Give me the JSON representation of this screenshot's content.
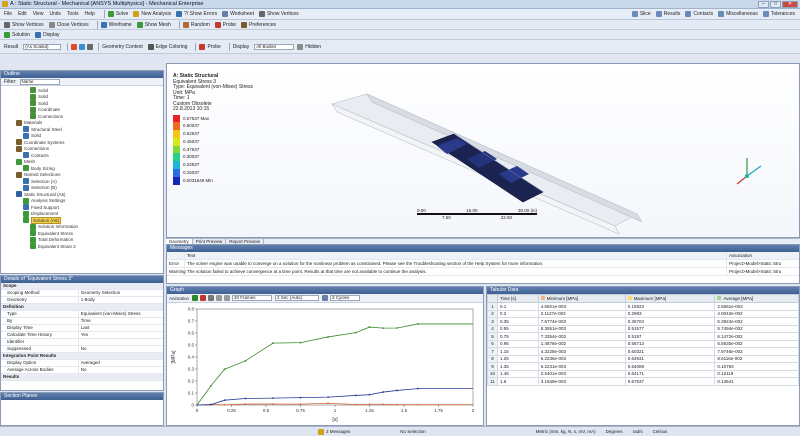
{
  "window": {
    "title": "A : Static Structural - Mechanical [ANSYS Multiphysics] - Mechanical Enterprise"
  },
  "menu": [
    "File",
    "Edit",
    "View",
    "Units",
    "Tools",
    "Help"
  ],
  "toolbar1": {
    "solve_label": "Solve",
    "new_analysis_label": "New Analysis",
    "show_errors_label": "?/ Show Errors",
    "worksheet_label": "Worksheet",
    "show_vertices_label": "Show Vertices"
  },
  "toolbar1_right": [
    "Slice",
    "Results",
    "Contacts",
    "Miscellaneous",
    "Tolerances"
  ],
  "toolbar2": [
    "Show Vertices",
    "Close Vertices",
    "Wireframe",
    "Show Mesh",
    "Random",
    "Probe",
    "Preferences"
  ],
  "toolbar3": [
    "Solution",
    "Display"
  ],
  "toolbar4": {
    "result_label": "Result",
    "result_value": "(As Scaled)",
    "geometry_label": "Geometry Context",
    "edge_coloring": "Edge Coloring",
    "probe": "Probe",
    "display": "Display",
    "display_value": "All Bodies",
    "hidden": "Hidden"
  },
  "outline": {
    "title": "Outline",
    "filter_label": "Filter:",
    "filter_value": "Name",
    "items": [
      {
        "label": "Solid",
        "indent": 3,
        "color": "#4a8f3a"
      },
      {
        "label": "Solid",
        "indent": 3,
        "color": "#4a8f3a"
      },
      {
        "label": "Solid",
        "indent": 3,
        "color": "#4a8f3a"
      },
      {
        "label": "Coordinate",
        "indent": 3,
        "color": "#4a8f3a"
      },
      {
        "label": "Connections",
        "indent": 3,
        "color": "#4a8f3a"
      },
      {
        "label": "Materials",
        "indent": 1,
        "color": "#7a5d2a"
      },
      {
        "label": "Structural Steel",
        "indent": 2,
        "color": "#3a6fb0"
      },
      {
        "label": "Solid",
        "indent": 2,
        "color": "#3a6fb0"
      },
      {
        "label": "Coordinate Systems",
        "indent": 1,
        "color": "#7a5d2a"
      },
      {
        "label": "Connections",
        "indent": 1,
        "color": "#7a5d2a"
      },
      {
        "label": "Contacts",
        "indent": 2,
        "color": "#3a6fb0"
      },
      {
        "label": "Mesh",
        "indent": 1,
        "color": "#3a9a3a"
      },
      {
        "label": "Body Sizing",
        "indent": 2,
        "color": "#3a9a3a"
      },
      {
        "label": "Named Selections",
        "indent": 1,
        "color": "#7a5d2a"
      },
      {
        "label": "Selection (A)",
        "indent": 2,
        "color": "#3a6fb0"
      },
      {
        "label": "Selection (B)",
        "indent": 2,
        "color": "#3a6fb0"
      },
      {
        "label": "Static Structural (A5)",
        "indent": 1,
        "color": "#2f5fa0"
      },
      {
        "label": "Analysis Settings",
        "indent": 2,
        "color": "#3a9a3a"
      },
      {
        "label": "Fixed Support",
        "indent": 2,
        "color": "#3a6fb0"
      },
      {
        "label": "Displacement",
        "indent": 2,
        "color": "#3a9a3a"
      },
      {
        "label": "Solution (A6)",
        "indent": 2,
        "color": "#3a9a3a",
        "highlight": true
      },
      {
        "label": "Solution Information",
        "indent": 3,
        "color": "#3a9a3a"
      },
      {
        "label": "Equivalent Stress",
        "indent": 3,
        "color": "#3a9a3a"
      },
      {
        "label": "Total Deformation",
        "indent": 3,
        "color": "#3a9a3a"
      },
      {
        "label": "Equivalent Strain 2",
        "indent": 3,
        "color": "#3a9a3a"
      }
    ]
  },
  "details": {
    "title": "Details of \"Equivalent Stress 3\"",
    "rows": [
      {
        "group": true,
        "k": "Scope"
      },
      {
        "k": "Scoping Method",
        "v": "Geometry Selection"
      },
      {
        "k": "Geometry",
        "v": "1 Body"
      },
      {
        "group": true,
        "k": "Definition"
      },
      {
        "k": "Type",
        "v": "Equivalent (von-Mises) Stress"
      },
      {
        "k": "By",
        "v": "Time"
      },
      {
        "k": "Display Time",
        "v": "Last"
      },
      {
        "k": "Calculate Time History",
        "v": "Yes"
      },
      {
        "k": "Identifier",
        "v": ""
      },
      {
        "k": "Suppressed",
        "v": "No"
      },
      {
        "group": true,
        "k": "Integration Point Results"
      },
      {
        "k": "Display Option",
        "v": "Averaged"
      },
      {
        "k": "Average Across Bodies",
        "v": "No"
      },
      {
        "group": true,
        "k": "Results"
      }
    ]
  },
  "section_planes": {
    "title": "Section Planes"
  },
  "viewport": {
    "title": "A: Static Structural",
    "subtitle": "Equivalent Stress 3",
    "lines": [
      "Type: Equivalent (von-Mises) Stress",
      "Unit: MPa",
      "Time: 1",
      "Custom Obsolete",
      "22.8.2013 10:15"
    ],
    "legend": [
      {
        "label": "0.67537 Max",
        "color": "#e8202a"
      },
      {
        "label": "0.60037",
        "color": "#f06a1e"
      },
      {
        "label": "0.52537",
        "color": "#f4c51c"
      },
      {
        "label": "0.45037",
        "color": "#d8e81a"
      },
      {
        "label": "0.37537",
        "color": "#7fd93a"
      },
      {
        "label": "0.30037",
        "color": "#2ccf8a"
      },
      {
        "label": "0.22537",
        "color": "#1fb7d6"
      },
      {
        "label": "0.15037",
        "color": "#2a6fe0"
      },
      {
        "label": "0.0031849 Min",
        "color": "#1428b8"
      }
    ],
    "scale": {
      "a": "0.00",
      "b": "15.00",
      "c": "30.00 (in)",
      "d": "7.50",
      "e": "22.50"
    }
  },
  "vp_tabs": [
    "Geometry",
    "Print Preview",
    "Report Preview"
  ],
  "messages": {
    "title": "Messages",
    "col_text": "Text",
    "col_assoc": "Association",
    "rows": [
      {
        "type": "Error",
        "text": "The solver engine was unable to converge on a solution for the nonlinear problem as constrained. Please see the Troubleshooting section of the Help System for more information.",
        "assoc": "Project>Model>Static Stru"
      },
      {
        "type": "Warning",
        "text": "The solution failed to achieve convergence at a time point. Results at that time are not available to continue the analysis.",
        "assoc": "Project>Model>Static Stru"
      }
    ]
  },
  "graph": {
    "title": "Graph",
    "animation_label": "Animation",
    "frames": "20 Frames",
    "speed": "2 Sec (Auto)",
    "cycles": "3 Cycles",
    "ylabel": "[MPa]",
    "xlabel": "[s]",
    "xticks": [
      "0",
      "0.25",
      "0.5",
      "0.75",
      "1",
      "1.25",
      "1.5",
      "1.75",
      "2"
    ],
    "yticks": [
      "0.8",
      "0.7",
      "0.6",
      "0.5",
      "0.4",
      "0.3",
      "0.2",
      "0.1",
      "0"
    ]
  },
  "tabular": {
    "title": "Tabular Data",
    "headers": [
      "Time [s]",
      "Minimum [MPa]",
      "Maximum [MPa]",
      "Average [MPa]"
    ],
    "rows": [
      [
        "0.1",
        "4.6921e-003",
        "0.15823",
        "2.6561e-003"
      ],
      [
        "0.2",
        "2.1127e-003",
        "0.2983",
        "4.0043e-002"
      ],
      [
        "0.35",
        "7.6774e-003",
        "0.36704",
        "5.3924e-002"
      ],
      [
        "0.55",
        "8.3551e-003",
        "0.51577",
        "5.7494e-002"
      ],
      [
        "0.75",
        "7.3354e-003",
        "0.5197",
        "6.1472e-002"
      ],
      [
        "0.95",
        "1.4876e-002",
        "0.56713",
        "6.5635e-002"
      ],
      [
        "1.15",
        "4.3228e-003",
        "0.60321",
        "7.9746e-002"
      ],
      [
        "1.25",
        "6.2236e-003",
        "0.64931",
        "8.6116e-002"
      ],
      [
        "1.35",
        "6.2231e-003",
        "0.64089",
        "0.10793"
      ],
      [
        "1.45",
        "2.5401e-003",
        "0.64171",
        "0.12119"
      ],
      [
        "1.6",
        "3.1849e-003",
        "0.67537",
        "0.13641"
      ]
    ]
  },
  "status": {
    "messages": "2 Messages",
    "selection": "No Selection",
    "units": "Metric (mm, kg, N, s, mV, mA)",
    "degrees": "Degrees",
    "rad": "rad/s",
    "celsius": "Celsius"
  }
}
